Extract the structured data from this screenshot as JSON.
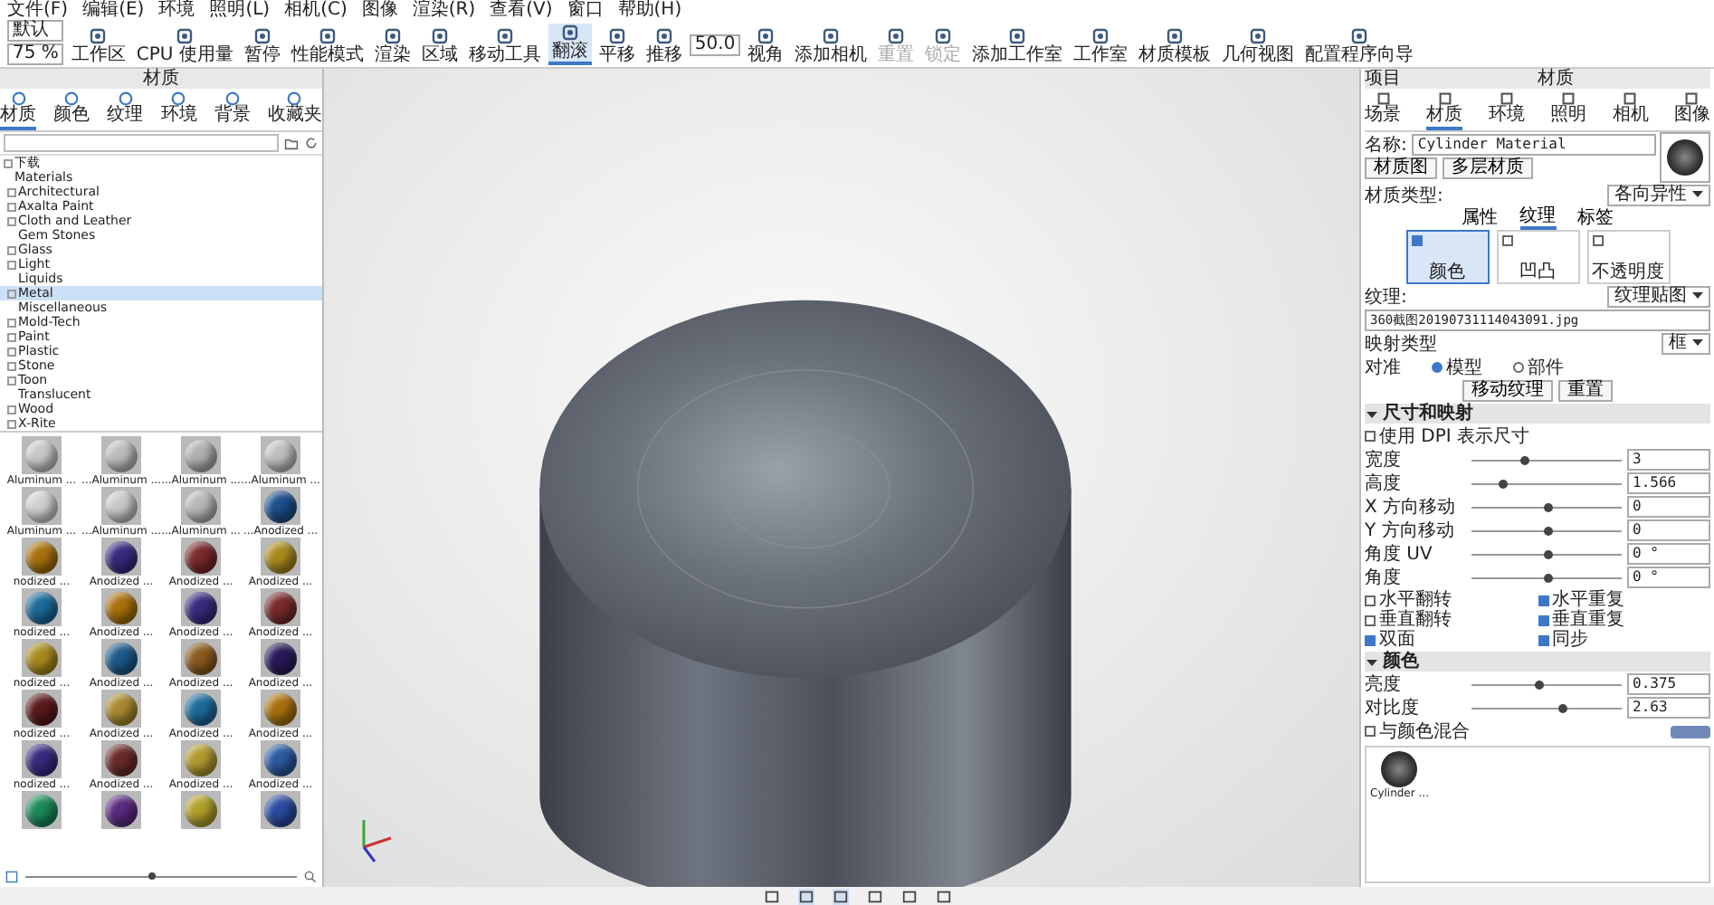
{
  "menu": [
    "文件(F)",
    "编辑(E)",
    "环境",
    "照明(L)",
    "相机(C)",
    "图像",
    "渲染(R)",
    "查看(V)",
    "窗口",
    "帮助(H)"
  ],
  "toolbar": {
    "dropdowns": [
      "默认",
      "75 %"
    ],
    "angle_value": "50.0",
    "tools": [
      {
        "label": "工作区",
        "selected": false,
        "disabled": false
      },
      {
        "label": "CPU 使用量",
        "selected": false,
        "disabled": false
      },
      {
        "label": "暂停",
        "selected": false,
        "disabled": false
      },
      {
        "label": "性能模式",
        "selected": false,
        "disabled": false
      },
      {
        "label": "渲染",
        "selected": false,
        "disabled": false
      },
      {
        "label": "区域",
        "selected": false,
        "disabled": false
      },
      {
        "label": "移动工具",
        "selected": false,
        "disabled": false
      },
      {
        "label": "翻滚",
        "selected": true,
        "disabled": false
      },
      {
        "label": "平移",
        "selected": false,
        "disabled": false
      },
      {
        "label": "推移",
        "selected": false,
        "disabled": false
      },
      {
        "label": "视角",
        "selected": false,
        "disabled": false
      },
      {
        "label": "添加相机",
        "selected": false,
        "disabled": false
      },
      {
        "label": "重置",
        "selected": false,
        "disabled": true
      },
      {
        "label": "锁定",
        "selected": false,
        "disabled": true
      },
      {
        "label": "添加工作室",
        "selected": false,
        "disabled": false
      },
      {
        "label": "工作室",
        "selected": false,
        "disabled": false
      },
      {
        "label": "材质模板",
        "selected": false,
        "disabled": false
      },
      {
        "label": "几何视图",
        "selected": false,
        "disabled": false
      },
      {
        "label": "配置程序向导",
        "selected": false,
        "disabled": false
      }
    ]
  },
  "library": {
    "title": "材质",
    "tabs": [
      {
        "label": "材质",
        "selected": true
      },
      {
        "label": "颜色",
        "selected": false
      },
      {
        "label": "纹理",
        "selected": false
      },
      {
        "label": "环境",
        "selected": false
      },
      {
        "label": "背景",
        "selected": false
      },
      {
        "label": "收藏夹",
        "selected": false
      }
    ],
    "tree": [
      {
        "label": "下载",
        "expandable": true,
        "selected": false
      },
      {
        "label": "Materials",
        "expandable": false,
        "selected": false,
        "children": [
          {
            "label": "Architectural",
            "expandable": true,
            "selected": false
          },
          {
            "label": "Axalta Paint",
            "expandable": true,
            "selected": false
          },
          {
            "label": "Cloth and Leather",
            "expandable": true,
            "selected": false
          },
          {
            "label": "Gem Stones",
            "expandable": false,
            "selected": false
          },
          {
            "label": "Glass",
            "expandable": true,
            "selected": false
          },
          {
            "label": "Light",
            "expandable": true,
            "selected": false
          },
          {
            "label": "Liquids",
            "expandable": false,
            "selected": false
          },
          {
            "label": "Metal",
            "expandable": true,
            "selected": true
          },
          {
            "label": "Miscellaneous",
            "expandable": false,
            "selected": false
          },
          {
            "label": "Mold-Tech",
            "expandable": true,
            "selected": false
          },
          {
            "label": "Paint",
            "expandable": true,
            "selected": false
          },
          {
            "label": "Plastic",
            "expandable": true,
            "selected": false
          },
          {
            "label": "Stone",
            "expandable": true,
            "selected": false
          },
          {
            "label": "Toon",
            "expandable": true,
            "selected": false
          },
          {
            "label": "Translucent",
            "expandable": false,
            "selected": false
          },
          {
            "label": "Wood",
            "expandable": true,
            "selected": false
          },
          {
            "label": "X-Rite",
            "expandable": true,
            "selected": false
          }
        ]
      }
    ],
    "materials": [
      {
        "label": "Aluminum ...",
        "color": "#c8c8c8"
      },
      {
        "label": "...Aluminum ...",
        "color": "#bdbdbd"
      },
      {
        "label": "...Aluminum ...",
        "color": "#b0b0b0"
      },
      {
        "label": "...Aluminum ...",
        "color": "#c0c0c0"
      },
      {
        "label": "Aluminum ...",
        "color": "#d0d0d0"
      },
      {
        "label": "...Aluminum ...",
        "color": "#c8c8c8"
      },
      {
        "label": "...Aluminum ...",
        "color": "#b8b8b8"
      },
      {
        "label": "...Anodized ...",
        "color": "#1e4f8a"
      },
      {
        "label": "nodized ...",
        "color": "#a8700e"
      },
      {
        "label": "Anodized ...",
        "color": "#3a2a80"
      },
      {
        "label": "Anodized ...",
        "color": "#7a2a2a"
      },
      {
        "label": "Anodized ...",
        "color": "#a88a1e"
      },
      {
        "label": "nodized ...",
        "color": "#1c6a9a"
      },
      {
        "label": "Anodized ...",
        "color": "#a8700e"
      },
      {
        "label": "Anodized ...",
        "color": "#3a2a80"
      },
      {
        "label": "Anodized ...",
        "color": "#7a2a2a"
      },
      {
        "label": "nodized ...",
        "color": "#a88a1e"
      },
      {
        "label": "Anodized ...",
        "color": "#1c5a8a"
      },
      {
        "label": "Anodized ...",
        "color": "#8a5a1e"
      },
      {
        "label": "Anodized ...",
        "color": "#2a1a5a"
      },
      {
        "label": "nodized ...",
        "color": "#5a1a1a"
      },
      {
        "label": "Anodized ...",
        "color": "#a88a2e"
      },
      {
        "label": "Anodized ...",
        "color": "#1c6a9a"
      },
      {
        "label": "Anodized ...",
        "color": "#a8700e"
      },
      {
        "label": "nodized ...",
        "color": "#3a2a80"
      },
      {
        "label": "Anodized ...",
        "color": "#6a2a2a"
      },
      {
        "label": "Anodized ...",
        "color": "#b09a2e"
      },
      {
        "label": "Anodized ...",
        "color": "#2a5aa0"
      },
      {
        "color": "#1a8a5a"
      },
      {
        "color": "#5a2a80"
      },
      {
        "color": "#b0a02a"
      },
      {
        "color": "#2a4aa0"
      }
    ],
    "zoom_slider": {
      "level": 0.45
    }
  },
  "project": {
    "title": "材质",
    "header": "项目",
    "tabs": [
      {
        "label": "场景",
        "selected": false
      },
      {
        "label": "材质",
        "selected": true
      },
      {
        "label": "环境",
        "selected": false
      },
      {
        "label": "照明",
        "selected": false
      },
      {
        "label": "相机",
        "selected": false
      },
      {
        "label": "图像",
        "selected": false
      }
    ],
    "name_label": "名称:",
    "name_value": "Cylinder Material",
    "buttons": [
      "材质图",
      "多层材质"
    ],
    "type_label": "材质类型:",
    "type_value": "各向异性",
    "subtabs": [
      {
        "label": "属性",
        "selected": false
      },
      {
        "label": "纹理",
        "selected": true
      },
      {
        "label": "标签",
        "selected": false
      }
    ],
    "channels": [
      {
        "label": "颜色",
        "checked": true,
        "selected": true
      },
      {
        "label": "凹凸",
        "checked": false,
        "selected": false
      },
      {
        "label": "不透明度",
        "checked": false,
        "selected": false
      }
    ],
    "texture_label": "纹理:",
    "texture_value": "纹理贴图",
    "file": "360截图20190731114043091.jpg",
    "mapping_label": "映射类型",
    "mapping_value": "框",
    "align_label": "对准",
    "align_options": [
      {
        "label": "模型",
        "selected": true
      },
      {
        "label": "部件",
        "selected": false
      }
    ],
    "actions": [
      "移动纹理",
      "重置"
    ],
    "size_section": {
      "title": "尺寸和映射",
      "expanded": true,
      "dpi": {
        "label": "使用 DPI 表示尺寸",
        "checked": false
      },
      "sliders": [
        {
          "label": "宽度",
          "value": "3",
          "level": 0.35
        },
        {
          "label": "高度",
          "value": "1.566",
          "level": 0.2
        },
        {
          "label": "X 方向移动",
          "value": "0",
          "level": 0.5
        },
        {
          "label": "Y 方向移动",
          "value": "0",
          "level": 0.5
        },
        {
          "label": "角度 UV",
          "value": "0 °",
          "level": 0.5
        },
        {
          "label": "角度",
          "value": "0 °",
          "level": 0.5
        }
      ],
      "checks": [
        {
          "label": "水平翻转",
          "checked": false
        },
        {
          "label": "水平重复",
          "checked": true
        },
        {
          "label": "垂直翻转",
          "checked": false
        },
        {
          "label": "垂直重复",
          "checked": true
        },
        {
          "label": "双面",
          "checked": true
        },
        {
          "label": "同步",
          "checked": true
        }
      ]
    },
    "color_section": {
      "title": "颜色",
      "expanded": true,
      "sliders": [
        {
          "label": "亮度",
          "value": "0.375",
          "level": 0.45
        },
        {
          "label": "对比度",
          "value": "2.63",
          "level": 0.6
        }
      ],
      "blend": {
        "label": "与颜色混合",
        "checked": false,
        "color": "#7189b8"
      }
    },
    "scene_materials": [
      {
        "label": "Cylinder ..."
      }
    ]
  }
}
